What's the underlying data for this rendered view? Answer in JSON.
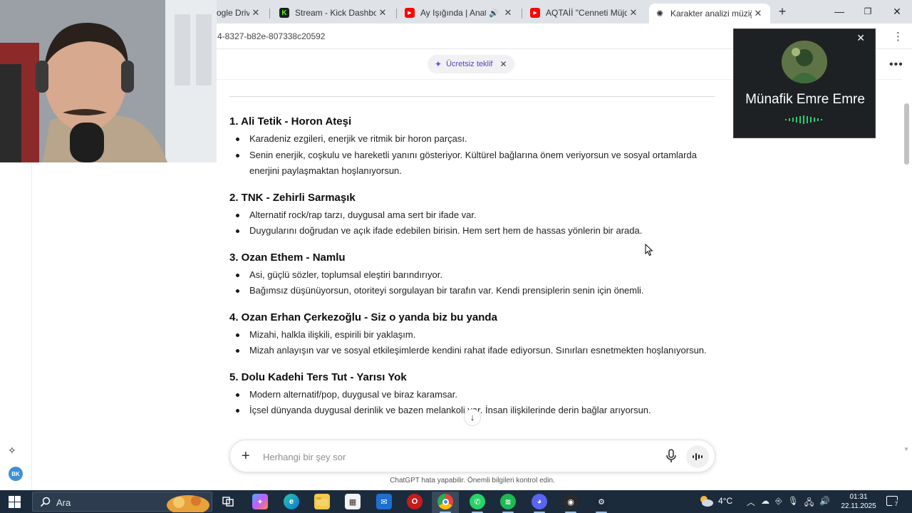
{
  "browser": {
    "tabs": [
      {
        "title": "ogle Drive",
        "icon": "google-drive-icon"
      },
      {
        "title": "Stream - Kick Dashboar",
        "icon": "kick-icon"
      },
      {
        "title": "Ay Işığında | Anatol",
        "icon": "youtube-icon",
        "audio": true
      },
      {
        "title": "AQTAİİ \"Cenneti Müjde",
        "icon": "youtube-icon"
      },
      {
        "title": "Karakter analizi müziğe",
        "icon": "chatgpt-icon",
        "active": true
      }
    ],
    "url": "4-8327-b82e-807338c20592"
  },
  "chatgpt": {
    "offer_label": "Ücretsiz teklif",
    "songs": [
      {
        "title": "1. Ali Tetik - Horon Ateşi",
        "bullets": [
          "Karadeniz ezgileri, enerjik ve ritmik bir horon parçası.",
          "Senin enerjik, coşkulu ve hareketli yanını gösteriyor. Kültürel bağlarına önem veriyorsun ve sosyal ortamlarda enerjini paylaşmaktan hoşlanıyorsun."
        ]
      },
      {
        "title": "2. TNK - Zehirli Sarmaşık",
        "bullets": [
          "Alternatif rock/rap tarzı, duygusal ama sert bir ifade var.",
          "Duygularını doğrudan ve açık ifade edebilen birisin. Hem sert hem de hassas yönlerin bir arada."
        ]
      },
      {
        "title": "3. Ozan Ethem - Namlu",
        "bullets": [
          "Asi, güçlü sözler, toplumsal eleştiri barındırıyor.",
          "Bağımsız düşünüyorsun, otoriteyi sorgulayan bir tarafın var. Kendi prensiplerin senin için önemli."
        ]
      },
      {
        "title": "4. Ozan Erhan Çerkezoğlu - Siz o yanda biz bu yanda",
        "bullets": [
          "Mizahi, halkla ilişkili, espirili bir yaklaşım.",
          "Mizah anlayışın var ve sosyal etkileşimlerde kendini rahat ifade ediyorsun. Sınırları esnetmekten hoşlanıyorsun."
        ]
      },
      {
        "title": "5. Dolu Kadehi Ters Tut - Yarısı Yok",
        "bullets": [
          "Modern alternatif/pop, duygusal ve biraz karamsar.",
          "İçsel dünyanda duygusal derinlik ve bazen melankoli var. İnsan ilişkilerinde derin bağlar arıyorsun."
        ]
      }
    ],
    "composer_placeholder": "Herhangi bir şey sor",
    "disclaimer": "ChatGPT hata yapabilir. Önemli bilgileri kontrol edin.",
    "user_initials": "BK"
  },
  "call": {
    "name": "Münafik Emre Emre"
  },
  "taskbar": {
    "search_label": "Ara",
    "weather_temp": "4°C",
    "time": "01:31",
    "date": "22.11.2025",
    "notification_count": "7"
  }
}
